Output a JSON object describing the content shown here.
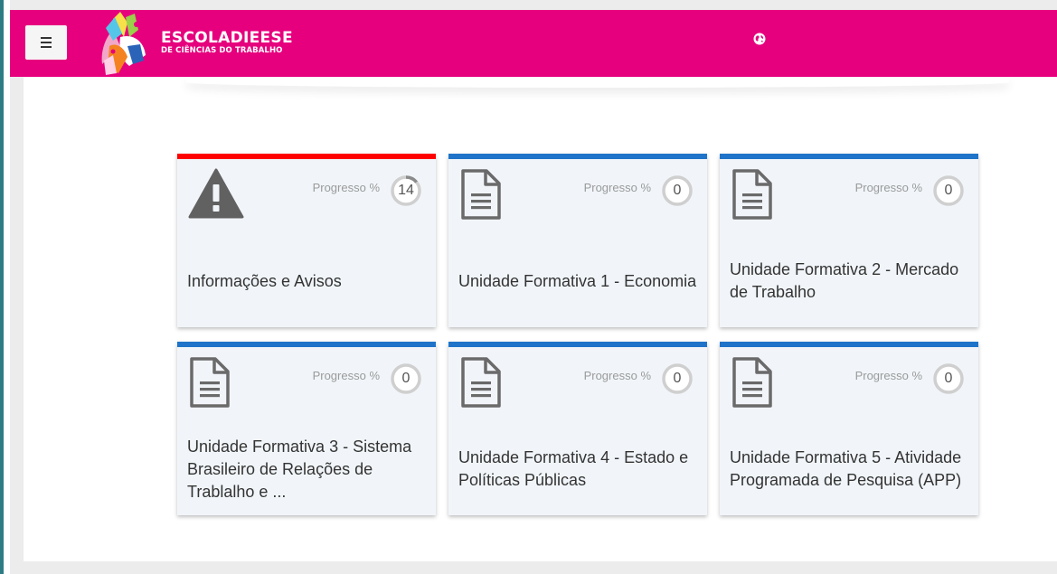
{
  "header": {
    "brand_main": "ESCOLADIEESE",
    "brand_sub": "DE CIÊNCIAS DO TRABALHO",
    "colors": {
      "bar": "#e6007e"
    },
    "icons": [
      "menu-icon",
      "globe-icon"
    ]
  },
  "cards": [
    {
      "title": "Informações e Avisos",
      "progress_label": "Progresso %",
      "progress": "14",
      "progress_fraction": 0.14,
      "accent": "#ff0000",
      "icon": "warning-icon"
    },
    {
      "title": "Unidade Formativa 1 - Economia",
      "progress_label": "Progresso %",
      "progress": "0",
      "progress_fraction": 0,
      "accent": "#1f74c9",
      "icon": "document-icon"
    },
    {
      "title": "Unidade Formativa 2 - Mercado de Trabalho",
      "progress_label": "Progresso %",
      "progress": "0",
      "progress_fraction": 0,
      "accent": "#1f74c9",
      "icon": "document-icon"
    },
    {
      "title": "Unidade Formativa 3 - Sistema Brasileiro de Relações de Trablalho e ...",
      "progress_label": "Progresso %",
      "progress": "0",
      "progress_fraction": 0,
      "accent": "#1f74c9",
      "icon": "document-icon"
    },
    {
      "title": "Unidade Formativa 4 - Estado e Políticas Públicas",
      "progress_label": "Progresso %",
      "progress": "0",
      "progress_fraction": 0,
      "accent": "#1f74c9",
      "icon": "document-icon"
    },
    {
      "title": "Unidade Formativa 5 - Atividade Programada de Pesquisa (APP)",
      "progress_label": "Progresso %",
      "progress": "0",
      "progress_fraction": 0,
      "accent": "#1f74c9",
      "icon": "document-icon"
    }
  ]
}
